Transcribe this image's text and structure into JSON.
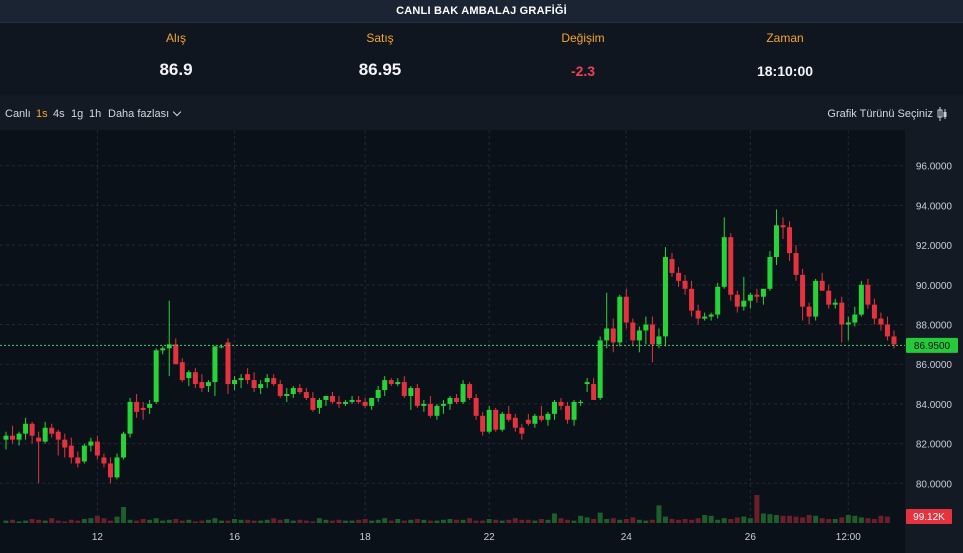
{
  "header": {
    "title": "CANLI BAK AMBALAJ GRAFİĞİ"
  },
  "stats": [
    {
      "label": "Alış",
      "value": "86.9"
    },
    {
      "label": "Satış",
      "value": "86.95"
    },
    {
      "label": "Değişim",
      "value": "-2.3"
    },
    {
      "label": "Zaman",
      "value": "18:10:00"
    }
  ],
  "toolbar": {
    "live": "Canlı",
    "intervals": [
      "1s",
      "4s",
      "1g",
      "1h"
    ],
    "active_interval": "1s",
    "more": "Daha fazlası",
    "chart_type": "Grafik Türünü Seçiniz",
    "chart_type_icon": "candlestick-icon"
  },
  "colors": {
    "up": "#26d43a",
    "down": "#e5323f",
    "accent": "#f5a623",
    "price_line": "#3fd46a"
  },
  "chart_data": {
    "type": "candlestick",
    "y_ticks": [
      "80.0000",
      "82.0000",
      "84.0000",
      "86.0000",
      "88.0000",
      "90.0000",
      "92.0000",
      "94.0000",
      "96.0000"
    ],
    "ylim": [
      78.0,
      97.8
    ],
    "x_ticks": [
      "12",
      "16",
      "18",
      "22",
      "24",
      "26",
      "12:00"
    ],
    "current_price_label": "86.9500",
    "current_price": 86.95,
    "volume_label": "99.12K",
    "grid": true,
    "ohlc": [
      [
        82.2,
        82.6,
        81.7,
        82.4
      ],
      [
        82.4,
        82.9,
        82.0,
        82.2
      ],
      [
        82.2,
        82.6,
        81.9,
        82.5
      ],
      [
        82.5,
        83.3,
        82.2,
        83.0
      ],
      [
        83.0,
        83.1,
        82.0,
        82.4
      ],
      [
        82.3,
        82.6,
        80.0,
        82.1
      ],
      [
        82.1,
        83.1,
        82.0,
        82.8
      ],
      [
        82.8,
        83.0,
        82.3,
        82.5
      ],
      [
        82.6,
        82.7,
        81.4,
        82.2
      ],
      [
        82.2,
        82.5,
        81.3,
        81.8
      ],
      [
        81.9,
        82.3,
        81.0,
        81.3
      ],
      [
        81.3,
        81.6,
        80.8,
        81.0
      ],
      [
        81.1,
        82.0,
        81.0,
        81.9
      ],
      [
        81.9,
        82.3,
        81.6,
        82.1
      ],
      [
        82.1,
        82.4,
        81.2,
        81.4
      ],
      [
        81.3,
        81.5,
        80.8,
        81.0
      ],
      [
        81.0,
        81.3,
        80.0,
        80.3
      ],
      [
        80.3,
        81.5,
        80.2,
        81.3
      ],
      [
        81.3,
        82.6,
        81.2,
        82.5
      ],
      [
        82.5,
        84.3,
        82.3,
        84.1
      ],
      [
        84.1,
        84.5,
        83.3,
        83.6
      ],
      [
        83.8,
        84.1,
        83.2,
        83.7
      ],
      [
        83.8,
        84.2,
        83.5,
        84.0
      ],
      [
        84.1,
        86.8,
        84.0,
        86.7
      ],
      [
        86.7,
        86.9,
        86.5,
        86.8
      ],
      [
        86.8,
        89.2,
        85.4,
        87.0
      ],
      [
        87.0,
        87.3,
        86.2,
        86.0
      ],
      [
        86.1,
        86.3,
        85.1,
        85.2
      ],
      [
        85.3,
        85.7,
        84.9,
        85.6
      ],
      [
        85.6,
        85.8,
        84.8,
        85.0
      ],
      [
        85.1,
        85.5,
        84.6,
        84.8
      ],
      [
        84.9,
        85.2,
        84.6,
        85.1
      ],
      [
        85.1,
        86.9,
        84.4,
        86.9
      ],
      [
        86.9,
        87.0,
        86.8,
        86.9
      ],
      [
        87.1,
        87.3,
        84.5,
        85.0
      ],
      [
        85.0,
        85.4,
        84.7,
        85.2
      ],
      [
        85.2,
        85.5,
        84.8,
        85.3
      ],
      [
        85.5,
        85.8,
        85.0,
        85.2
      ],
      [
        85.2,
        85.6,
        84.6,
        84.8
      ],
      [
        84.8,
        85.2,
        84.5,
        85.0
      ],
      [
        85.1,
        85.5,
        84.8,
        85.3
      ],
      [
        85.3,
        85.5,
        84.9,
        85.0
      ],
      [
        85.0,
        85.2,
        84.3,
        84.4
      ],
      [
        84.4,
        84.8,
        84.1,
        84.5
      ],
      [
        84.5,
        84.9,
        84.3,
        84.8
      ],
      [
        84.8,
        85.0,
        84.5,
        84.6
      ],
      [
        84.6,
        84.8,
        84.2,
        84.3
      ],
      [
        84.3,
        84.6,
        83.6,
        83.7
      ],
      [
        83.8,
        84.3,
        83.5,
        84.2
      ],
      [
        84.2,
        84.4,
        83.9,
        84.4
      ],
      [
        84.4,
        84.6,
        84.0,
        84.1
      ],
      [
        84.1,
        84.4,
        83.8,
        84.0
      ],
      [
        84.0,
        84.2,
        83.9,
        84.1
      ],
      [
        84.1,
        84.4,
        84.0,
        84.2
      ],
      [
        84.2,
        84.4,
        84.0,
        84.1
      ],
      [
        84.1,
        84.3,
        83.8,
        83.9
      ],
      [
        83.9,
        84.3,
        83.7,
        84.3
      ],
      [
        84.3,
        84.9,
        84.1,
        84.7
      ],
      [
        84.7,
        85.4,
        84.4,
        85.2
      ],
      [
        85.2,
        85.3,
        84.9,
        85.0
      ],
      [
        85.0,
        85.3,
        84.9,
        85.1
      ],
      [
        85.1,
        85.4,
        84.3,
        84.4
      ],
      [
        84.4,
        84.9,
        83.7,
        84.8
      ],
      [
        84.8,
        85.0,
        83.8,
        83.9
      ],
      [
        83.9,
        84.2,
        83.6,
        84.0
      ],
      [
        84.0,
        84.4,
        83.3,
        83.4
      ],
      [
        83.4,
        84.0,
        83.2,
        83.9
      ],
      [
        83.9,
        84.2,
        83.5,
        84.0
      ],
      [
        84.0,
        84.4,
        83.7,
        84.3
      ],
      [
        84.3,
        84.5,
        84.0,
        84.1
      ],
      [
        84.1,
        85.2,
        84.0,
        85.0
      ],
      [
        85.0,
        85.1,
        84.2,
        84.3
      ],
      [
        84.3,
        84.5,
        83.2,
        83.4
      ],
      [
        83.4,
        83.6,
        82.4,
        82.6
      ],
      [
        82.6,
        83.9,
        82.5,
        83.7
      ],
      [
        83.7,
        83.8,
        82.6,
        82.7
      ],
      [
        82.7,
        83.6,
        82.6,
        83.5
      ],
      [
        83.5,
        83.9,
        83.1,
        83.2
      ],
      [
        83.3,
        83.5,
        82.6,
        82.8
      ],
      [
        82.8,
        83.0,
        82.2,
        82.5
      ],
      [
        83.2,
        83.5,
        82.9,
        83.0
      ],
      [
        83.0,
        83.5,
        82.8,
        83.4
      ],
      [
        83.4,
        83.9,
        83.1,
        83.2
      ],
      [
        83.2,
        83.6,
        82.9,
        83.5
      ],
      [
        83.5,
        84.2,
        83.2,
        84.1
      ],
      [
        84.1,
        84.3,
        83.7,
        83.9
      ],
      [
        83.9,
        84.1,
        83.0,
        83.2
      ],
      [
        83.2,
        84.2,
        82.9,
        84.1
      ],
      [
        84.1,
        84.2,
        83.9,
        84.1
      ],
      [
        85.0,
        85.3,
        84.6,
        85.1
      ],
      [
        85.0,
        85.3,
        84.4,
        84.2
      ],
      [
        84.3,
        87.4,
        84.2,
        87.2
      ],
      [
        87.2,
        89.6,
        86.8,
        87.8
      ],
      [
        87.8,
        88.3,
        86.6,
        87.1
      ],
      [
        87.1,
        89.5,
        86.9,
        89.4
      ],
      [
        89.4,
        89.8,
        87.8,
        88.1
      ],
      [
        88.1,
        88.3,
        86.9,
        87.2
      ],
      [
        87.2,
        87.9,
        86.6,
        87.7
      ],
      [
        87.7,
        88.4,
        87.0,
        88.0
      ],
      [
        88.0,
        88.4,
        86.1,
        87.0
      ],
      [
        87.0,
        87.8,
        86.8,
        87.4
      ],
      [
        87.4,
        91.9,
        86.9,
        91.4
      ],
      [
        91.3,
        91.6,
        90.4,
        90.6
      ],
      [
        90.6,
        90.9,
        89.9,
        90.2
      ],
      [
        90.2,
        90.5,
        89.5,
        89.8
      ],
      [
        89.8,
        90.2,
        88.4,
        88.7
      ],
      [
        88.7,
        89.0,
        88.0,
        88.3
      ],
      [
        88.3,
        88.6,
        88.2,
        88.4
      ],
      [
        88.4,
        88.6,
        88.2,
        88.5
      ],
      [
        88.5,
        90.1,
        88.3,
        89.9
      ],
      [
        89.9,
        93.4,
        89.8,
        92.4
      ],
      [
        92.4,
        92.6,
        89.2,
        89.5
      ],
      [
        89.5,
        89.7,
        88.6,
        88.9
      ],
      [
        88.9,
        90.4,
        88.7,
        89.2
      ],
      [
        89.2,
        89.6,
        88.8,
        89.5
      ],
      [
        89.5,
        89.8,
        89.1,
        89.4
      ],
      [
        89.4,
        89.7,
        89.0,
        89.8
      ],
      [
        89.8,
        91.7,
        89.7,
        91.4
      ],
      [
        91.4,
        93.8,
        91.0,
        93.0
      ],
      [
        93.0,
        93.4,
        92.3,
        92.9
      ],
      [
        92.9,
        93.2,
        91.2,
        91.6
      ],
      [
        91.6,
        92.0,
        90.2,
        90.5
      ],
      [
        90.5,
        90.8,
        88.2,
        88.9
      ],
      [
        88.9,
        89.1,
        88.0,
        88.4
      ],
      [
        88.4,
        90.3,
        88.2,
        90.2
      ],
      [
        90.2,
        90.6,
        89.8,
        89.7
      ],
      [
        89.7,
        90.0,
        88.8,
        89.0
      ],
      [
        89.0,
        89.3,
        88.8,
        89.1
      ],
      [
        89.1,
        89.4,
        87.1,
        88.0
      ],
      [
        88.0,
        88.4,
        87.2,
        88.1
      ],
      [
        88.1,
        88.9,
        87.9,
        88.5
      ],
      [
        88.5,
        90.2,
        88.4,
        90.0
      ],
      [
        90.0,
        90.3,
        88.8,
        89.0
      ],
      [
        89.0,
        89.3,
        88.0,
        88.3
      ],
      [
        88.3,
        88.6,
        87.7,
        88.0
      ],
      [
        88.0,
        88.4,
        87.2,
        87.4
      ],
      [
        87.4,
        87.7,
        86.8,
        87.0
      ]
    ],
    "volume": [
      3,
      4,
      2,
      3,
      5,
      4,
      3,
      6,
      3,
      2,
      4,
      3,
      5,
      6,
      9,
      6,
      3,
      8,
      20,
      4,
      3,
      5,
      4,
      6,
      3,
      4,
      5,
      3,
      4,
      2,
      3,
      4,
      6,
      3,
      3,
      5,
      4,
      4,
      3,
      3,
      4,
      6,
      4,
      5,
      3,
      4,
      3,
      2,
      6,
      4,
      3,
      4,
      3,
      3,
      4,
      5,
      3,
      4,
      6,
      3,
      5,
      3,
      4,
      5,
      4,
      3,
      3,
      4,
      5,
      4,
      4,
      6,
      3,
      3,
      5,
      4,
      3,
      4,
      6,
      4,
      4,
      3,
      5,
      4,
      12,
      6,
      4,
      3,
      9,
      7,
      5,
      13,
      5,
      6,
      4,
      5,
      7,
      4,
      3,
      4,
      22,
      8,
      5,
      4,
      5,
      4,
      6,
      10,
      9,
      4,
      6,
      5,
      7,
      8,
      6,
      35,
      12,
      11,
      10,
      9,
      9,
      8,
      7,
      10,
      9,
      6,
      5,
      5,
      7,
      10,
      9,
      7,
      6,
      5,
      9,
      8
    ]
  }
}
